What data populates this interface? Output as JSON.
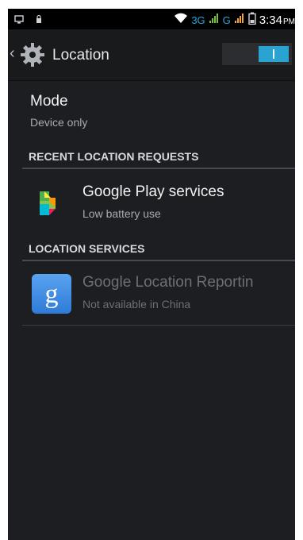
{
  "status_bar": {
    "network_3g": "3G",
    "network_g": "G",
    "time": "3:34",
    "ampm": "PM"
  },
  "app_bar": {
    "title": "Location"
  },
  "mode": {
    "title": "Mode",
    "subtitle": "Device only"
  },
  "sections": {
    "recent": "RECENT LOCATION REQUESTS",
    "services": "LOCATION SERVICES"
  },
  "recent_items": [
    {
      "title": "Google Play services",
      "subtitle": "Low battery use",
      "icon": "google-play-services-icon"
    }
  ],
  "service_items": [
    {
      "title": "Google Location Reportin",
      "subtitle": "Not available in China",
      "icon": "google-g-icon"
    }
  ],
  "colors": {
    "accent": "#2aa3d1",
    "background": "#1c1e21"
  }
}
